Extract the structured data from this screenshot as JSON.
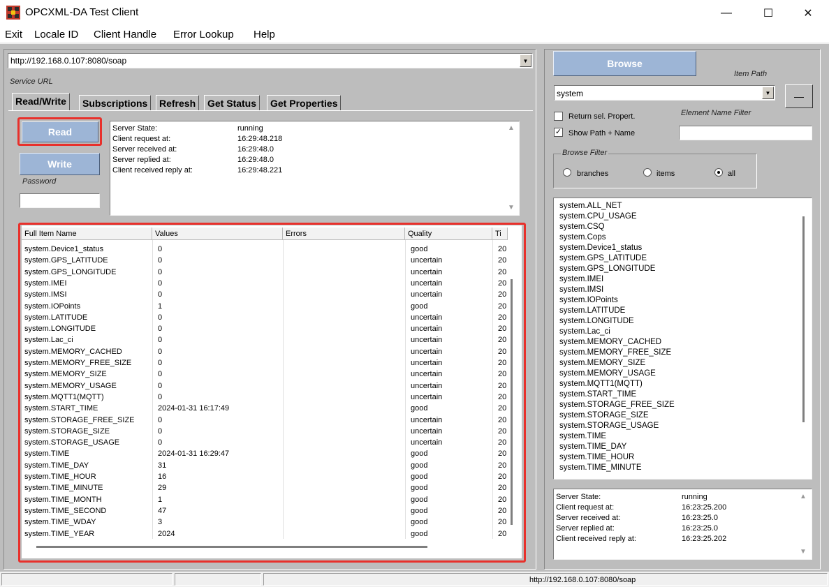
{
  "window": {
    "title": "OPCXML-DA Test Client",
    "minimize_glyph": "—",
    "maximize_glyph": "☐",
    "close_glyph": "✕"
  },
  "menu": [
    "Exit",
    "Locale ID",
    "Client Handle",
    "Error Lookup",
    "Help"
  ],
  "service": {
    "url": "http://192.168.0.107:8080/soap",
    "label": "Service URL"
  },
  "tabs": [
    "Read/Write",
    "Subscriptions",
    "Refresh",
    "Get Status",
    "Get Properties"
  ],
  "buttons": {
    "read": "Read",
    "write": "Write",
    "browse": "Browse",
    "item_path_btn": "—"
  },
  "password_label": "Password",
  "left_status": [
    {
      "label": "Server State:",
      "value": "running"
    },
    {
      "label": "Client request at:",
      "value": "16:29:48.218"
    },
    {
      "label": "Server received at:",
      "value": "16:29:48.0"
    },
    {
      "label": "Server replied at:",
      "value": "16:29:48.0"
    },
    {
      "label": "Client received reply at:",
      "value": "16:29:48.221"
    }
  ],
  "grid": {
    "headers": [
      "Full Item Name",
      "Values",
      "Errors",
      "Quality",
      "Ti"
    ],
    "rows": [
      [
        "system.Device1_status",
        "0",
        "",
        "good",
        "20"
      ],
      [
        "system.GPS_LATITUDE",
        "0",
        "",
        "uncertain",
        "20"
      ],
      [
        "system.GPS_LONGITUDE",
        "0",
        "",
        "uncertain",
        "20"
      ],
      [
        "system.IMEI",
        "0",
        "",
        "uncertain",
        "20"
      ],
      [
        "system.IMSI",
        "0",
        "",
        "uncertain",
        "20"
      ],
      [
        "system.IOPoints",
        "1",
        "",
        "good",
        "20"
      ],
      [
        "system.LATITUDE",
        "0",
        "",
        "uncertain",
        "20"
      ],
      [
        "system.LONGITUDE",
        "0",
        "",
        "uncertain",
        "20"
      ],
      [
        "system.Lac_ci",
        "0",
        "",
        "uncertain",
        "20"
      ],
      [
        "system.MEMORY_CACHED",
        "0",
        "",
        "uncertain",
        "20"
      ],
      [
        "system.MEMORY_FREE_SIZE",
        "0",
        "",
        "uncertain",
        "20"
      ],
      [
        "system.MEMORY_SIZE",
        "0",
        "",
        "uncertain",
        "20"
      ],
      [
        "system.MEMORY_USAGE",
        "0",
        "",
        "uncertain",
        "20"
      ],
      [
        "system.MQTT1(MQTT)",
        "0",
        "",
        "uncertain",
        "20"
      ],
      [
        "system.START_TIME",
        "2024-01-31 16:17:49",
        "",
        "good",
        "20"
      ],
      [
        "system.STORAGE_FREE_SIZE",
        "0",
        "",
        "uncertain",
        "20"
      ],
      [
        "system.STORAGE_SIZE",
        "0",
        "",
        "uncertain",
        "20"
      ],
      [
        "system.STORAGE_USAGE",
        "0",
        "",
        "uncertain",
        "20"
      ],
      [
        "system.TIME",
        "2024-01-31 16:29:47",
        "",
        "good",
        "20"
      ],
      [
        "system.TIME_DAY",
        "31",
        "",
        "good",
        "20"
      ],
      [
        "system.TIME_HOUR",
        "16",
        "",
        "good",
        "20"
      ],
      [
        "system.TIME_MINUTE",
        "29",
        "",
        "good",
        "20"
      ],
      [
        "system.TIME_MONTH",
        "1",
        "",
        "good",
        "20"
      ],
      [
        "system.TIME_SECOND",
        "47",
        "",
        "good",
        "20"
      ],
      [
        "system.TIME_WDAY",
        "3",
        "",
        "good",
        "20"
      ],
      [
        "system.TIME_YEAR",
        "2024",
        "",
        "good",
        "20"
      ]
    ]
  },
  "right": {
    "item_path_label": "Item Path",
    "item_path_value": "system",
    "return_sel_propert": "Return sel. Propert.",
    "show_path_name": "Show Path + Name",
    "element_name_filter_label": "Element Name Filter",
    "element_name_filter_value": "",
    "browse_filter_label": "Browse Filter",
    "filter_options": [
      "branches",
      "items",
      "all"
    ],
    "selected_filter": "all",
    "browse_items": [
      "system.ALL_NET",
      "system.CPU_USAGE",
      "system.CSQ",
      "system.Cops",
      "system.Device1_status",
      "system.GPS_LATITUDE",
      "system.GPS_LONGITUDE",
      "system.IMEI",
      "system.IMSI",
      "system.IOPoints",
      "system.LATITUDE",
      "system.LONGITUDE",
      "system.Lac_ci",
      "system.MEMORY_CACHED",
      "system.MEMORY_FREE_SIZE",
      "system.MEMORY_SIZE",
      "system.MEMORY_USAGE",
      "system.MQTT1(MQTT)",
      "system.START_TIME",
      "system.STORAGE_FREE_SIZE",
      "system.STORAGE_SIZE",
      "system.STORAGE_USAGE",
      "system.TIME",
      "system.TIME_DAY",
      "system.TIME_HOUR",
      "system.TIME_MINUTE"
    ],
    "status": [
      {
        "label": "Server State:",
        "value": "running"
      },
      {
        "label": "Client request at:",
        "value": "16:23:25.200"
      },
      {
        "label": "Server received at:",
        "value": "16:23:25.0"
      },
      {
        "label": "Server replied at:",
        "value": "16:23:25.0"
      },
      {
        "label": "Client received reply at:",
        "value": "16:23:25.202"
      }
    ]
  },
  "statusbar": {
    "url": "http://192.168.0.107:8080/soap"
  },
  "colors": {
    "highlight_box": "#e8302b",
    "button_blue": "#9db5d6",
    "panel_gray": "#bdbdbd"
  }
}
